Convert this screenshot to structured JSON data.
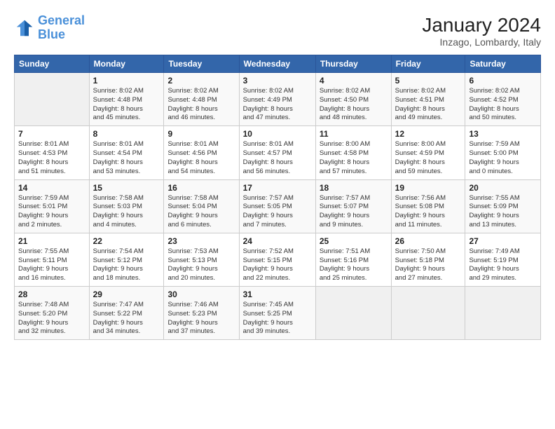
{
  "header": {
    "logo_line1": "General",
    "logo_line2": "Blue",
    "title": "January 2024",
    "subtitle": "Inzago, Lombardy, Italy"
  },
  "columns": [
    "Sunday",
    "Monday",
    "Tuesday",
    "Wednesday",
    "Thursday",
    "Friday",
    "Saturday"
  ],
  "weeks": [
    [
      {
        "day": "",
        "info": ""
      },
      {
        "day": "1",
        "info": "Sunrise: 8:02 AM\nSunset: 4:48 PM\nDaylight: 8 hours\nand 45 minutes."
      },
      {
        "day": "2",
        "info": "Sunrise: 8:02 AM\nSunset: 4:48 PM\nDaylight: 8 hours\nand 46 minutes."
      },
      {
        "day": "3",
        "info": "Sunrise: 8:02 AM\nSunset: 4:49 PM\nDaylight: 8 hours\nand 47 minutes."
      },
      {
        "day": "4",
        "info": "Sunrise: 8:02 AM\nSunset: 4:50 PM\nDaylight: 8 hours\nand 48 minutes."
      },
      {
        "day": "5",
        "info": "Sunrise: 8:02 AM\nSunset: 4:51 PM\nDaylight: 8 hours\nand 49 minutes."
      },
      {
        "day": "6",
        "info": "Sunrise: 8:02 AM\nSunset: 4:52 PM\nDaylight: 8 hours\nand 50 minutes."
      }
    ],
    [
      {
        "day": "7",
        "info": "Sunrise: 8:01 AM\nSunset: 4:53 PM\nDaylight: 8 hours\nand 51 minutes."
      },
      {
        "day": "8",
        "info": "Sunrise: 8:01 AM\nSunset: 4:54 PM\nDaylight: 8 hours\nand 53 minutes."
      },
      {
        "day": "9",
        "info": "Sunrise: 8:01 AM\nSunset: 4:56 PM\nDaylight: 8 hours\nand 54 minutes."
      },
      {
        "day": "10",
        "info": "Sunrise: 8:01 AM\nSunset: 4:57 PM\nDaylight: 8 hours\nand 56 minutes."
      },
      {
        "day": "11",
        "info": "Sunrise: 8:00 AM\nSunset: 4:58 PM\nDaylight: 8 hours\nand 57 minutes."
      },
      {
        "day": "12",
        "info": "Sunrise: 8:00 AM\nSunset: 4:59 PM\nDaylight: 8 hours\nand 59 minutes."
      },
      {
        "day": "13",
        "info": "Sunrise: 7:59 AM\nSunset: 5:00 PM\nDaylight: 9 hours\nand 0 minutes."
      }
    ],
    [
      {
        "day": "14",
        "info": "Sunrise: 7:59 AM\nSunset: 5:01 PM\nDaylight: 9 hours\nand 2 minutes."
      },
      {
        "day": "15",
        "info": "Sunrise: 7:58 AM\nSunset: 5:03 PM\nDaylight: 9 hours\nand 4 minutes."
      },
      {
        "day": "16",
        "info": "Sunrise: 7:58 AM\nSunset: 5:04 PM\nDaylight: 9 hours\nand 6 minutes."
      },
      {
        "day": "17",
        "info": "Sunrise: 7:57 AM\nSunset: 5:05 PM\nDaylight: 9 hours\nand 7 minutes."
      },
      {
        "day": "18",
        "info": "Sunrise: 7:57 AM\nSunset: 5:07 PM\nDaylight: 9 hours\nand 9 minutes."
      },
      {
        "day": "19",
        "info": "Sunrise: 7:56 AM\nSunset: 5:08 PM\nDaylight: 9 hours\nand 11 minutes."
      },
      {
        "day": "20",
        "info": "Sunrise: 7:55 AM\nSunset: 5:09 PM\nDaylight: 9 hours\nand 13 minutes."
      }
    ],
    [
      {
        "day": "21",
        "info": "Sunrise: 7:55 AM\nSunset: 5:11 PM\nDaylight: 9 hours\nand 16 minutes."
      },
      {
        "day": "22",
        "info": "Sunrise: 7:54 AM\nSunset: 5:12 PM\nDaylight: 9 hours\nand 18 minutes."
      },
      {
        "day": "23",
        "info": "Sunrise: 7:53 AM\nSunset: 5:13 PM\nDaylight: 9 hours\nand 20 minutes."
      },
      {
        "day": "24",
        "info": "Sunrise: 7:52 AM\nSunset: 5:15 PM\nDaylight: 9 hours\nand 22 minutes."
      },
      {
        "day": "25",
        "info": "Sunrise: 7:51 AM\nSunset: 5:16 PM\nDaylight: 9 hours\nand 25 minutes."
      },
      {
        "day": "26",
        "info": "Sunrise: 7:50 AM\nSunset: 5:18 PM\nDaylight: 9 hours\nand 27 minutes."
      },
      {
        "day": "27",
        "info": "Sunrise: 7:49 AM\nSunset: 5:19 PM\nDaylight: 9 hours\nand 29 minutes."
      }
    ],
    [
      {
        "day": "28",
        "info": "Sunrise: 7:48 AM\nSunset: 5:20 PM\nDaylight: 9 hours\nand 32 minutes."
      },
      {
        "day": "29",
        "info": "Sunrise: 7:47 AM\nSunset: 5:22 PM\nDaylight: 9 hours\nand 34 minutes."
      },
      {
        "day": "30",
        "info": "Sunrise: 7:46 AM\nSunset: 5:23 PM\nDaylight: 9 hours\nand 37 minutes."
      },
      {
        "day": "31",
        "info": "Sunrise: 7:45 AM\nSunset: 5:25 PM\nDaylight: 9 hours\nand 39 minutes."
      },
      {
        "day": "",
        "info": ""
      },
      {
        "day": "",
        "info": ""
      },
      {
        "day": "",
        "info": ""
      }
    ]
  ]
}
